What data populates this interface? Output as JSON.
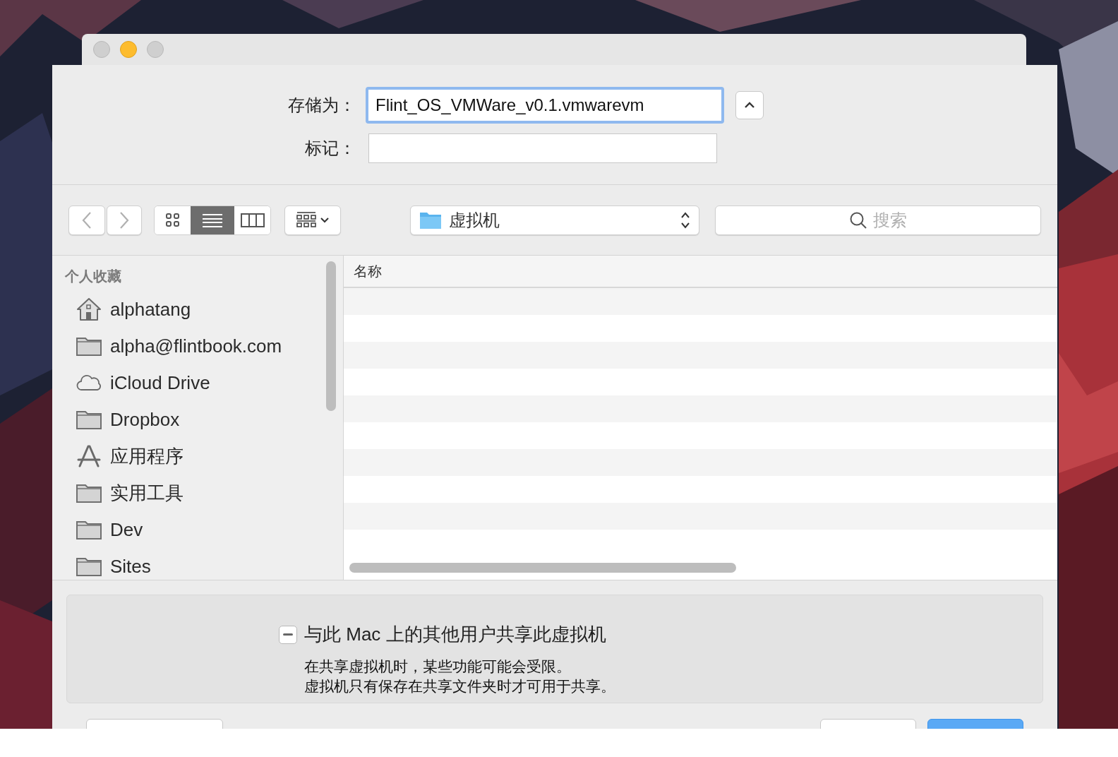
{
  "save_as": {
    "label": "存储为：",
    "value": "Flint_OS_VMWare_v0.1.vmwarevm",
    "focused": true
  },
  "tags": {
    "label": "标记："
  },
  "toolbar": {
    "views": [
      {
        "kind": "icons",
        "selected": false
      },
      {
        "kind": "list",
        "selected": true
      },
      {
        "kind": "columns",
        "selected": false
      }
    ],
    "location": "虚拟机",
    "search": {
      "placeholder": "搜索"
    }
  },
  "sidebar": {
    "heading": "个人收藏",
    "items": [
      {
        "kind": "home",
        "label": "alphatang"
      },
      {
        "kind": "folder",
        "label": "alpha@flintbook.com"
      },
      {
        "kind": "cloud",
        "label": "iCloud Drive"
      },
      {
        "kind": "folder",
        "label": "Dropbox"
      },
      {
        "kind": "apps",
        "label": "应用程序"
      },
      {
        "kind": "folder",
        "label": "实用工具"
      },
      {
        "kind": "folder",
        "label": "Dev"
      },
      {
        "kind": "folder",
        "label": "Sites"
      }
    ]
  },
  "file_list": {
    "columns": [
      "名称"
    ]
  },
  "sharing": {
    "label": "与此 Mac 上的其他用户共享此虚拟机",
    "mixed": true,
    "notes": [
      "在共享虚拟机时，某些功能可能会受限。",
      "虚拟机只有保存在共享文件夹时才可用于共享。"
    ]
  },
  "bottom_buttons": [
    {
      "default": false
    },
    {
      "default": false
    },
    {
      "default": true
    }
  ]
}
